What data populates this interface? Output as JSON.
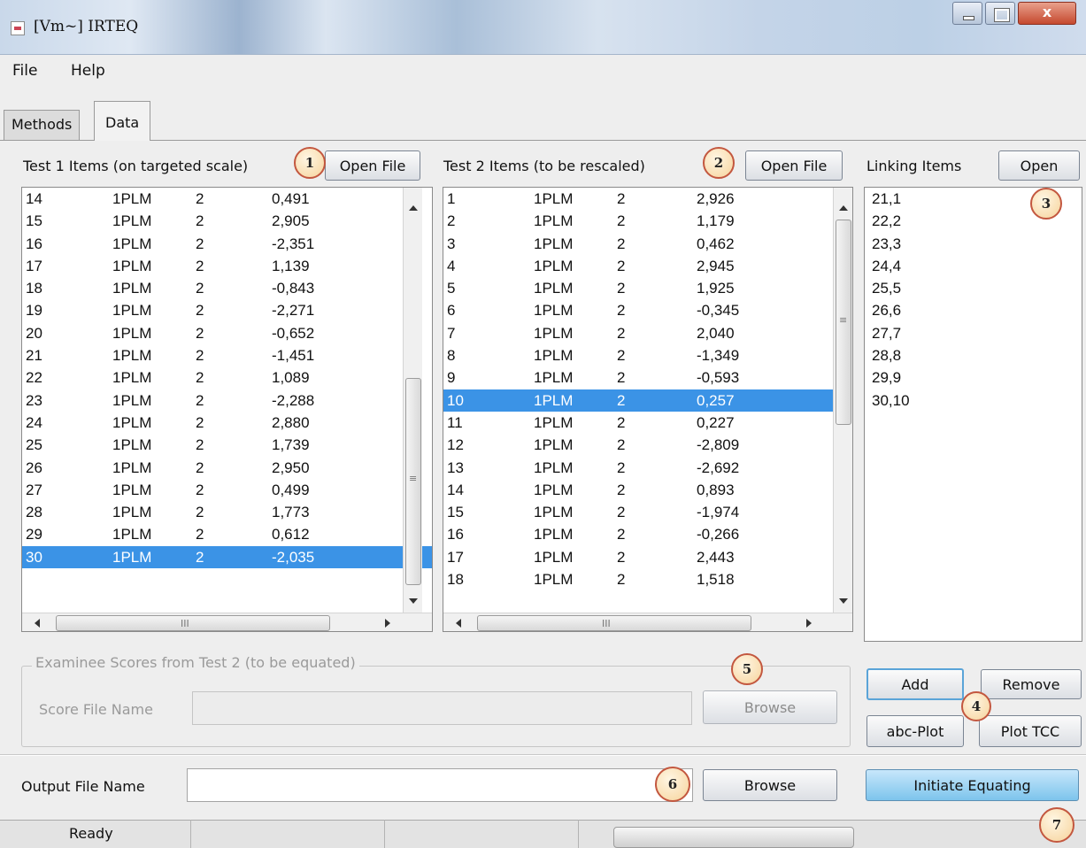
{
  "window": {
    "title": "[Vm~] IRTEQ",
    "close_glyph": "x"
  },
  "menu": {
    "file": "File",
    "help": "Help"
  },
  "tabs": {
    "methods": "Methods",
    "data": "Data"
  },
  "test1": {
    "label": "Test 1 Items (on targeted scale)",
    "open_label": "Open File",
    "selected_item": "30",
    "rows": [
      [
        "14",
        "1PLM",
        "2",
        "0,491"
      ],
      [
        "15",
        "1PLM",
        "2",
        "2,905"
      ],
      [
        "16",
        "1PLM",
        "2",
        "-2,351"
      ],
      [
        "17",
        "1PLM",
        "2",
        "1,139"
      ],
      [
        "18",
        "1PLM",
        "2",
        "-0,843"
      ],
      [
        "19",
        "1PLM",
        "2",
        "-2,271"
      ],
      [
        "20",
        "1PLM",
        "2",
        "-0,652"
      ],
      [
        "21",
        "1PLM",
        "2",
        "-1,451"
      ],
      [
        "22",
        "1PLM",
        "2",
        "1,089"
      ],
      [
        "23",
        "1PLM",
        "2",
        "-2,288"
      ],
      [
        "24",
        "1PLM",
        "2",
        "2,880"
      ],
      [
        "25",
        "1PLM",
        "2",
        "1,739"
      ],
      [
        "26",
        "1PLM",
        "2",
        "2,950"
      ],
      [
        "27",
        "1PLM",
        "2",
        "0,499"
      ],
      [
        "28",
        "1PLM",
        "2",
        "1,773"
      ],
      [
        "29",
        "1PLM",
        "2",
        "0,612"
      ],
      [
        "30",
        "1PLM",
        "2",
        "-2,035"
      ]
    ]
  },
  "test2": {
    "label": "Test 2 Items (to be rescaled)",
    "open_label": "Open File",
    "selected_item": "10",
    "rows": [
      [
        "1",
        "1PLM",
        "2",
        "2,926"
      ],
      [
        "2",
        "1PLM",
        "2",
        "1,179"
      ],
      [
        "3",
        "1PLM",
        "2",
        "0,462"
      ],
      [
        "4",
        "1PLM",
        "2",
        "2,945"
      ],
      [
        "5",
        "1PLM",
        "2",
        "1,925"
      ],
      [
        "6",
        "1PLM",
        "2",
        "-0,345"
      ],
      [
        "7",
        "1PLM",
        "2",
        "2,040"
      ],
      [
        "8",
        "1PLM",
        "2",
        "-1,349"
      ],
      [
        "9",
        "1PLM",
        "2",
        "-0,593"
      ],
      [
        "10",
        "1PLM",
        "2",
        "0,257"
      ],
      [
        "11",
        "1PLM",
        "2",
        "0,227"
      ],
      [
        "12",
        "1PLM",
        "2",
        "-2,809"
      ],
      [
        "13",
        "1PLM",
        "2",
        "-2,692"
      ],
      [
        "14",
        "1PLM",
        "2",
        "0,893"
      ],
      [
        "15",
        "1PLM",
        "2",
        "-1,974"
      ],
      [
        "16",
        "1PLM",
        "2",
        "-0,266"
      ],
      [
        "17",
        "1PLM",
        "2",
        "2,443"
      ],
      [
        "18",
        "1PLM",
        "2",
        "1,518"
      ]
    ]
  },
  "linking": {
    "label": "Linking Items",
    "open_label": "Open",
    "items": [
      "21,1",
      "22,2",
      "23,3",
      "24,4",
      "25,5",
      "26,6",
      "27,7",
      "28,8",
      "29,9",
      "30,10"
    ]
  },
  "examinee": {
    "legend": "Examinee Scores from Test 2 (to be equated)",
    "score_file_label": "Score File Name",
    "score_file_value": "",
    "browse_label": "Browse"
  },
  "actions": {
    "add_label": "Add",
    "remove_label": "Remove",
    "abc_plot_label": "abc-Plot",
    "plot_tcc_label": "Plot TCC"
  },
  "output": {
    "label": "Output File Name",
    "value": "",
    "browse_label": "Browse",
    "initiate_label": "Initiate Equating"
  },
  "status": {
    "text": "Ready"
  },
  "scroll_glyphs": {
    "grip_vertical": "≡",
    "grip_horizontal": "III"
  },
  "callouts": [
    "1",
    "2",
    "3",
    "4",
    "5",
    "6",
    "7"
  ]
}
